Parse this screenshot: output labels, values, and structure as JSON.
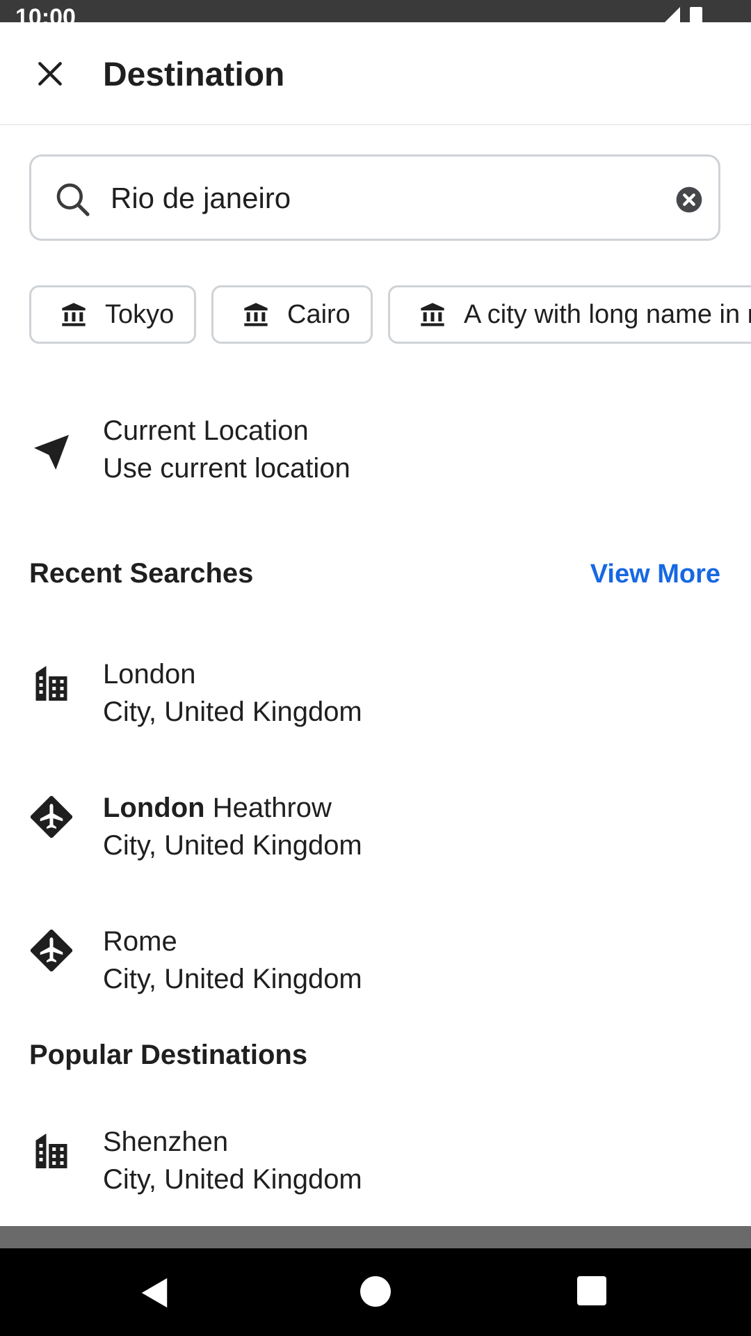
{
  "status_bar": {
    "time": "10:00"
  },
  "header": {
    "title": "Destination",
    "close_icon": "close-icon"
  },
  "search": {
    "value": "Rio de janeiro",
    "search_icon": "search-icon",
    "clear_icon": "clear-circle-icon"
  },
  "chips": [
    {
      "label": "Tokyo",
      "icon": "museum-icon"
    },
    {
      "label": "Cairo",
      "icon": "museum-icon"
    },
    {
      "label": "A city with long name in ma",
      "icon": "museum-icon"
    }
  ],
  "current_location": {
    "title": "Current Location",
    "subtitle": "Use current location",
    "icon": "navigation-arrow-icon"
  },
  "recent": {
    "title": "Recent Searches",
    "view_more": "View More",
    "items": [
      {
        "title": "London",
        "title_bold": "",
        "title_rest": "",
        "subtitle": "City, United Kingdom",
        "icon": "city-buildings-icon"
      },
      {
        "title": "",
        "title_bold": "London",
        "title_rest": " Heathrow",
        "subtitle": "City, United Kingdom",
        "icon": "airport-icon"
      },
      {
        "title": "Rome",
        "title_bold": "",
        "title_rest": "",
        "subtitle": "City, United Kingdom",
        "icon": "airport-icon"
      }
    ]
  },
  "popular": {
    "title": "Popular Destinations",
    "items": [
      {
        "title": "Shenzhen",
        "subtitle": "City, United Kingdom",
        "icon": "city-buildings-icon"
      }
    ]
  },
  "colors": {
    "accent": "#1668e3",
    "text": "#1f1f1f",
    "border": "#cfd2d6"
  }
}
